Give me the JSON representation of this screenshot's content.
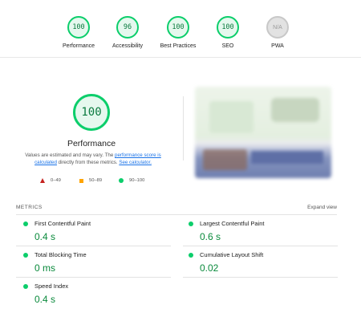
{
  "categories": [
    {
      "score": "100",
      "label": "Performance"
    },
    {
      "score": "96",
      "label": "Accessibility"
    },
    {
      "score": "100",
      "label": "Best Practices"
    },
    {
      "score": "100",
      "label": "SEO"
    },
    {
      "score": "N/A",
      "label": "PWA"
    }
  ],
  "performance": {
    "score": "100",
    "title": "Performance",
    "desc_prefix": "Values are estimated and may vary. The ",
    "desc_link1": "performance score is calculated",
    "desc_middle": " directly from these metrics. ",
    "desc_link2": "See calculator."
  },
  "legend": {
    "fail": "0–49",
    "average": "50–89",
    "pass": "90–100"
  },
  "metrics": {
    "header": "METRICS",
    "expand_label": "Expand view",
    "items": [
      {
        "label": "First Contentful Paint",
        "value": "0.4 s"
      },
      {
        "label": "Largest Contentful Paint",
        "value": "0.6 s"
      },
      {
        "label": "Total Blocking Time",
        "value": "0 ms"
      },
      {
        "label": "Cumulative Layout Shift",
        "value": "0.02"
      },
      {
        "label": "Speed Index",
        "value": "0.4 s"
      }
    ]
  },
  "colors": {
    "pass": "#0cce6b",
    "average": "#ffa400",
    "fail": "#c5221f",
    "link": "#1a73e8"
  }
}
